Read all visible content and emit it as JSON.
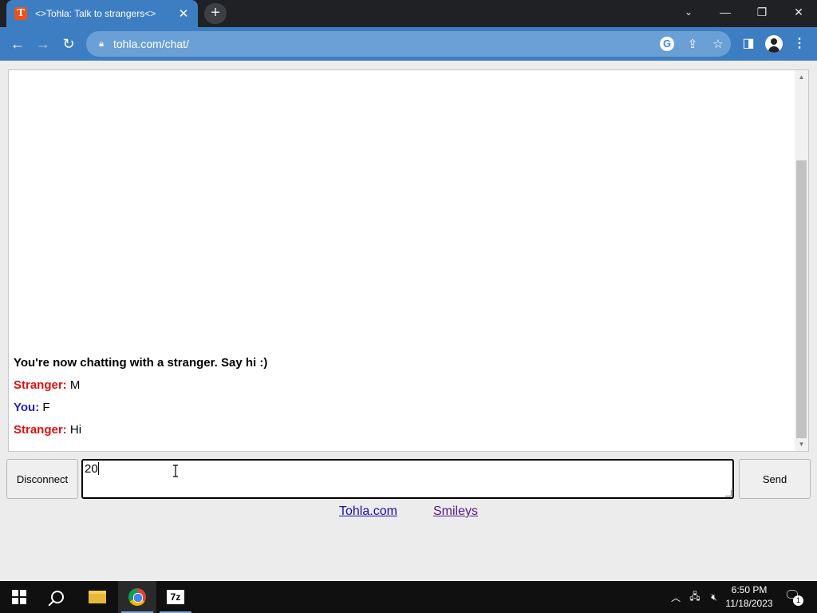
{
  "browser": {
    "tab_title": "<>Tohla: Talk to strangers<>",
    "favicon_letter": "T",
    "url": "tohla.com/chat/"
  },
  "chat": {
    "status": "You're now chatting with a stranger. Say hi :)",
    "messages": [
      {
        "who": "Stranger:",
        "text": "M",
        "color": "#e01010"
      },
      {
        "who": "You:",
        "text": "F",
        "color": "#1f1fc8"
      },
      {
        "who": "Stranger:",
        "text": "Hi",
        "color": "#e01010"
      }
    ],
    "input_value": "20",
    "disconnect_label": "Disconnect",
    "send_label": "Send"
  },
  "links": {
    "home": "Tohla.com",
    "smileys": "Smileys"
  },
  "taskbar": {
    "sevenzip_label": "7z",
    "time": "6:50 PM",
    "date": "11/18/2023",
    "notification_count": "1"
  }
}
